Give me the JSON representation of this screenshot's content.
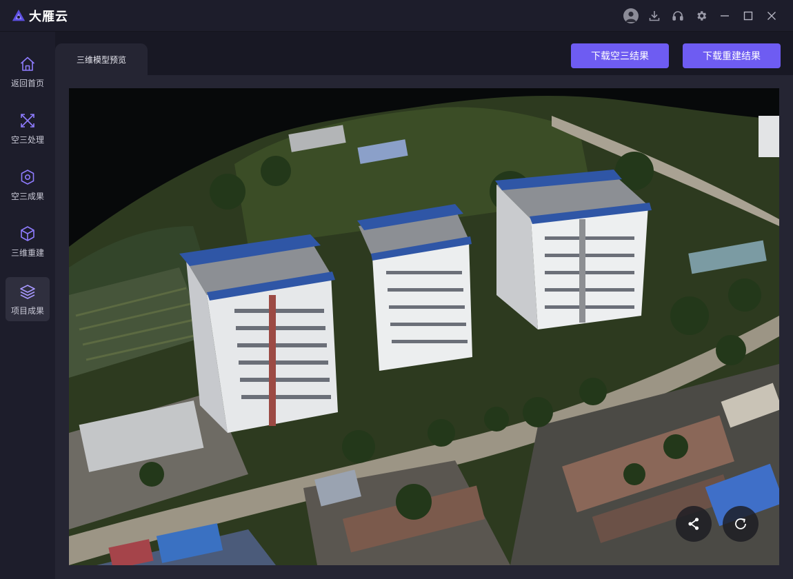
{
  "app": {
    "name": "大雁云",
    "logo_icon": "dayan-logo-icon",
    "accent_color": "#6e5cf2"
  },
  "titlebar": {
    "controls": [
      {
        "name": "user-avatar-icon"
      },
      {
        "name": "download-icon"
      },
      {
        "name": "headset-icon"
      },
      {
        "name": "gear-icon"
      },
      {
        "name": "minimize-icon"
      },
      {
        "name": "maximize-icon"
      },
      {
        "name": "close-icon"
      }
    ]
  },
  "sidebar": {
    "items": [
      {
        "label": "返回首页",
        "icon": "home-icon",
        "active": false
      },
      {
        "label": "空三处理",
        "icon": "aerotriangulation-icon",
        "active": false
      },
      {
        "label": "空三成果",
        "icon": "aero-result-icon",
        "active": false
      },
      {
        "label": "三维重建",
        "icon": "cube-icon",
        "active": false
      },
      {
        "label": "项目成果",
        "icon": "layers-icon",
        "active": true
      }
    ]
  },
  "main": {
    "tab_label": "三维模型预览",
    "buttons": {
      "download_aero": "下载空三结果",
      "download_recon": "下载重建结果"
    },
    "viewer": {
      "content": "3D photogrammetry model of residential high-rise buildings",
      "controls": [
        "share-icon",
        "reset-view-icon"
      ]
    }
  }
}
